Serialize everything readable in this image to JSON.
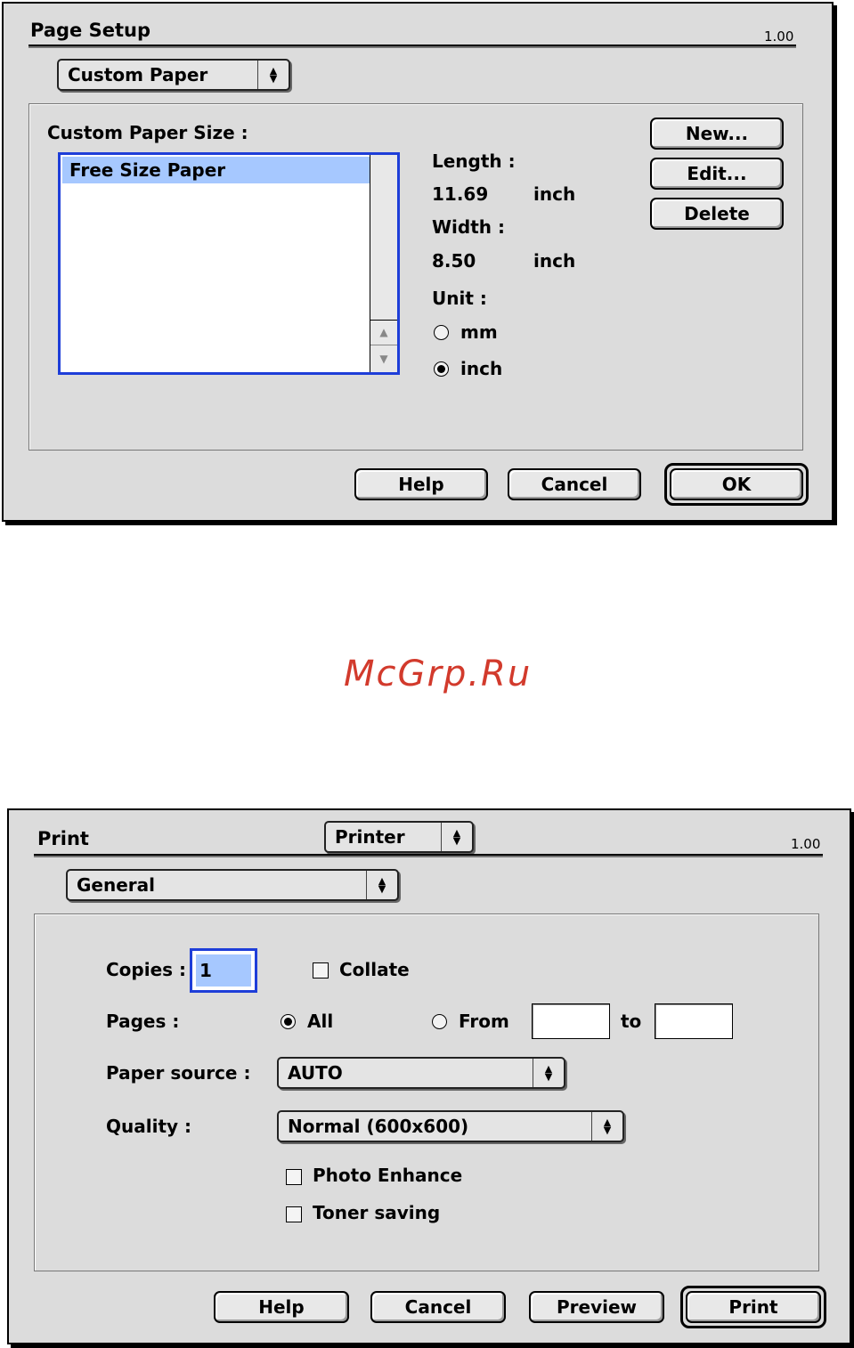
{
  "page_setup": {
    "title": "Page Setup",
    "version": "1.00",
    "mode_popup": "Custom Paper",
    "custom_paper_size_label": "Custom Paper Size :",
    "list_items": [
      "Free Size Paper"
    ],
    "length_label": "Length :",
    "length_value": "11.69",
    "length_unit": "inch",
    "width_label": "Width :",
    "width_value": "8.50",
    "width_unit": "inch",
    "unit_label": "Unit :",
    "unit_options": [
      {
        "label": "mm",
        "selected": false
      },
      {
        "label": "inch",
        "selected": true
      }
    ],
    "new_button": "New...",
    "edit_button": "Edit...",
    "delete_button": "Delete",
    "help_button": "Help",
    "cancel_button": "Cancel",
    "ok_button": "OK"
  },
  "watermark": "McGrp.Ru",
  "print": {
    "title": "Print",
    "printer_popup": "Printer",
    "version": "1.00",
    "panel_popup": "General",
    "copies_label": "Copies :",
    "copies_value": "1",
    "collate_label": "Collate",
    "collate_checked": false,
    "pages_label": "Pages :",
    "pages_all_label": "All",
    "pages_all_selected": true,
    "pages_from_label": "From",
    "pages_from_value": "",
    "pages_to_label": "to",
    "pages_to_value": "",
    "paper_source_label": "Paper source :",
    "paper_source_value": "AUTO",
    "quality_label": "Quality :",
    "quality_value": "Normal (600x600)",
    "photo_enhance_label": "Photo Enhance",
    "photo_enhance_checked": false,
    "toner_saving_label": "Toner saving",
    "toner_saving_checked": false,
    "help_button": "Help",
    "cancel_button": "Cancel",
    "preview_button": "Preview",
    "print_button": "Print"
  },
  "colors": {
    "selection": "#a6c8ff",
    "focus_ring": "#1e3ed8",
    "watermark": "#d23a2c",
    "dialog_bg": "#dcdcdc"
  }
}
